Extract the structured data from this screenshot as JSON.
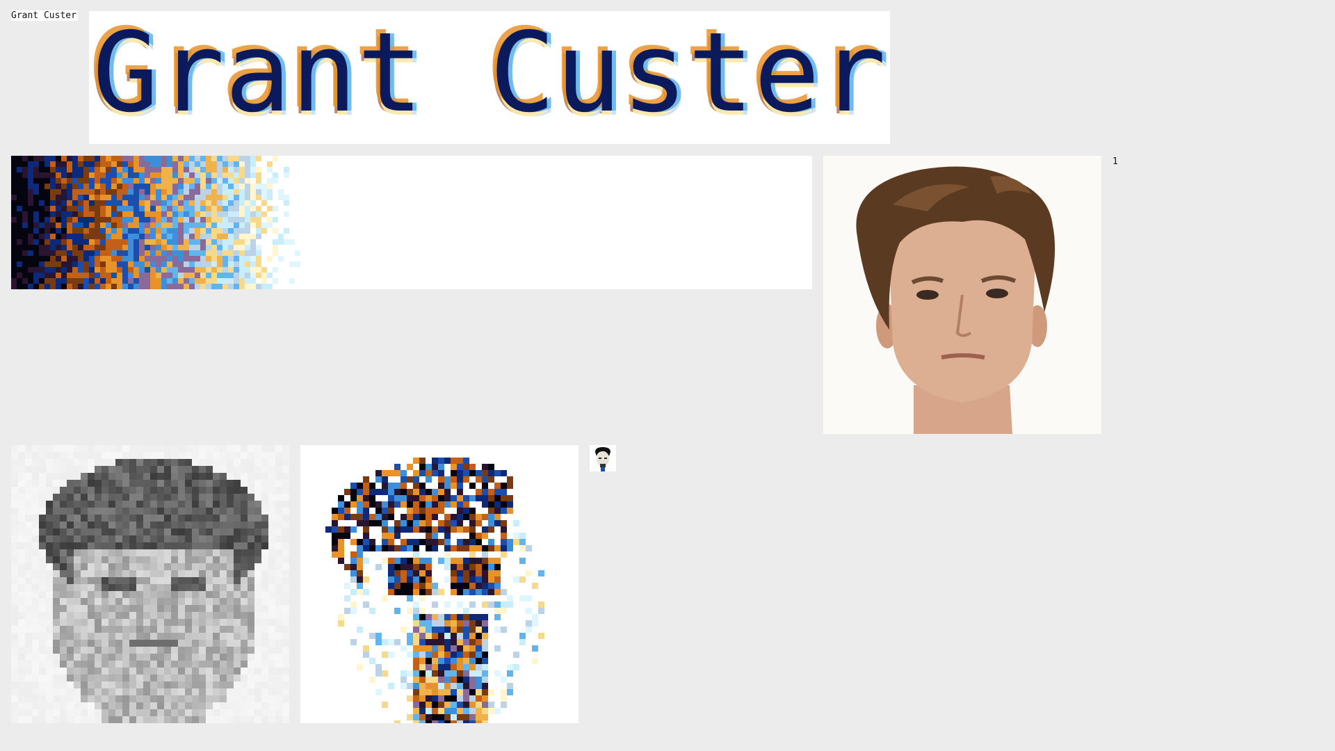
{
  "site": {
    "name": "Grant Custer",
    "title": "Grant Custer"
  },
  "counter": "1",
  "palette_colors": [
    "#050510",
    "#2a1530",
    "#0d2a7a",
    "#7a3a12",
    "#c2601a",
    "#1a4fb0",
    "#e8922a",
    "#3c8fd8",
    "#8a6a9a",
    "#f0b24a",
    "#62b4ec",
    "#bcd2e6",
    "#f6d98a",
    "#c8eefc",
    "#fff6d0",
    "#e0f6ff"
  ],
  "colors": {
    "background": "#ececec",
    "panel": "#ffffff",
    "skin": "#d9a98a",
    "hair": "#5b3a22"
  }
}
